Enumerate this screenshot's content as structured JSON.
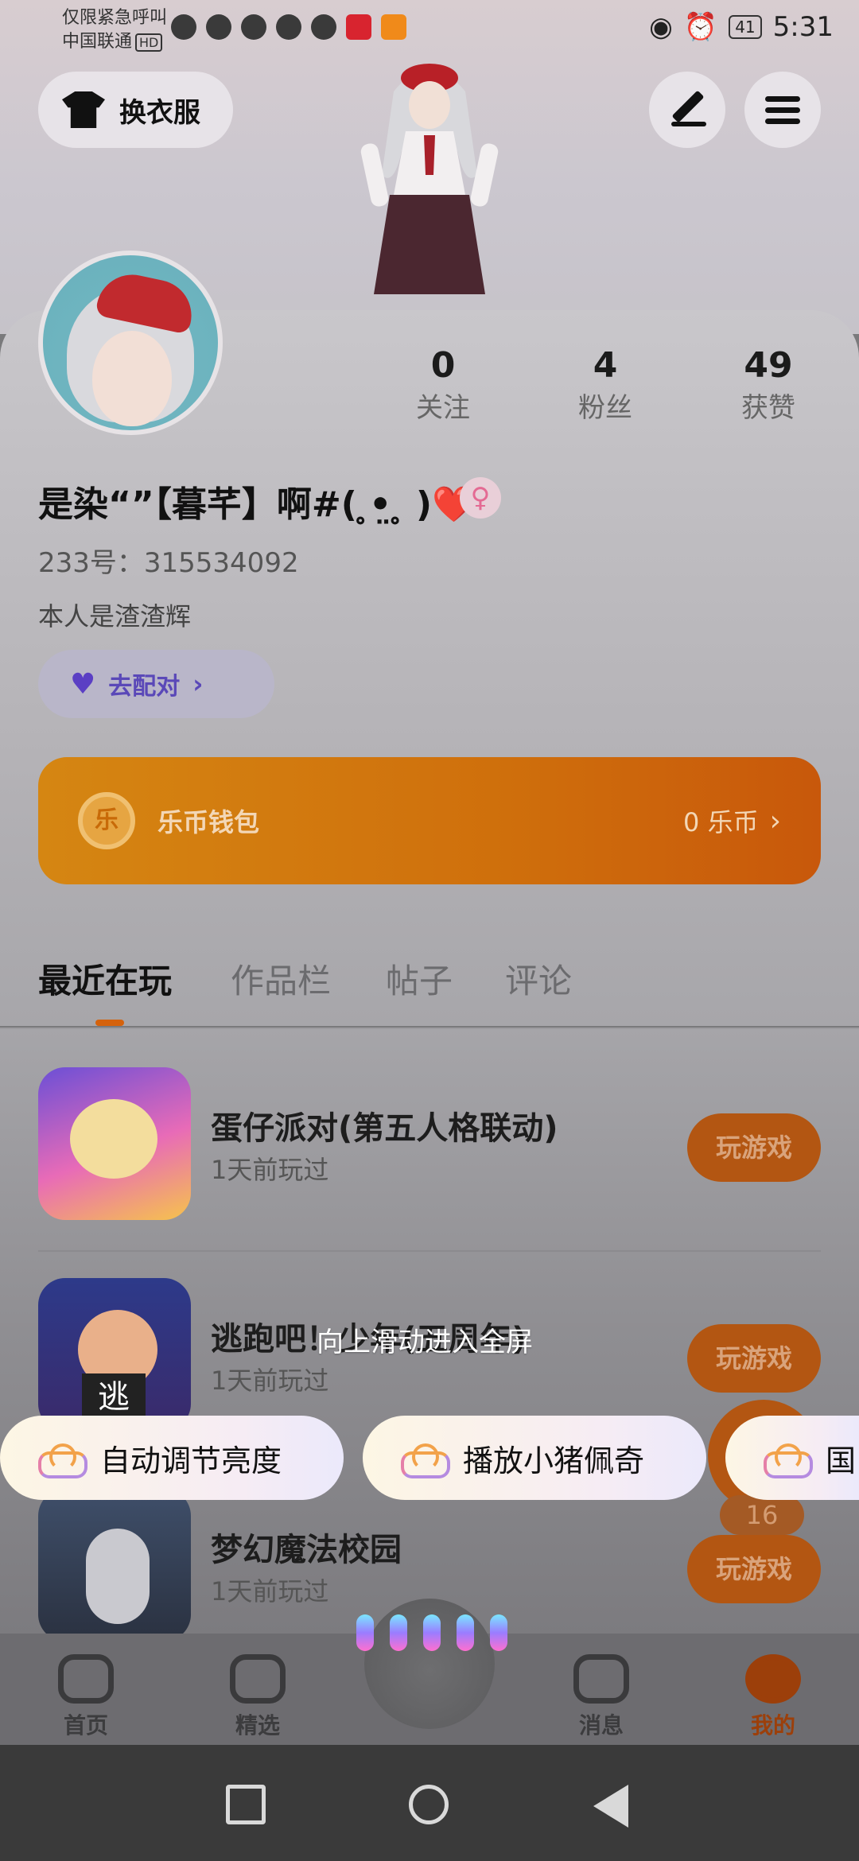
{
  "status": {
    "carrier_line1": "仅限紧急呼叫",
    "carrier_line2": "中国联通",
    "hd": "HD",
    "battery": "41",
    "time": "5:31"
  },
  "header": {
    "outfit_label": "换衣服"
  },
  "profile": {
    "stats": [
      {
        "value": "0",
        "label": "关注"
      },
      {
        "value": "4",
        "label": "粉丝"
      },
      {
        "value": "49",
        "label": "获赞"
      }
    ],
    "name": "是染“”【暮芊】啊#( ̥•̤ ̥ )❤️",
    "gender_symbol": "♀",
    "uid": "233号：315534092",
    "bio": "本人是渣渣辉",
    "match_label": "去配对"
  },
  "wallet": {
    "coin_glyph": "乐",
    "title": "乐币钱包",
    "value": "0 乐币"
  },
  "tabs": [
    "最近在玩",
    "作品栏",
    "帖子",
    "评论"
  ],
  "games": [
    {
      "title": "蛋仔派对(第五人格联动)",
      "sub": "1天前玩过",
      "btn": "玩游戏"
    },
    {
      "title": "逃跑吧！少年(五周年)",
      "sub": "1天前玩过",
      "btn": "玩游戏"
    },
    {
      "title": "梦幻魔法校园",
      "sub": "1天前玩过",
      "btn": "玩游戏"
    }
  ],
  "overlay": {
    "swipe_hint": "向上滑动进入全屏",
    "suggestions": [
      "自动调节亮度",
      "播放小猪佩奇",
      "国"
    ],
    "badge": "16"
  },
  "bottom_nav": [
    {
      "label": "首页",
      "icon": "gamepad-icon"
    },
    {
      "label": "精选",
      "icon": "heart-shield-icon"
    },
    {
      "label": "消息",
      "icon": "chat-icon"
    },
    {
      "label": "我的",
      "icon": "face-icon"
    }
  ]
}
